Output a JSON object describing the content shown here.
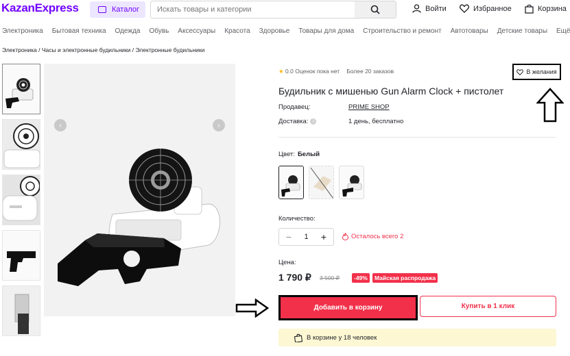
{
  "header": {
    "logo": "KazanExpress",
    "catalog_label": "Каталог",
    "search_placeholder": "Искать товары и категории",
    "login_label": "Войти",
    "favorites_label": "Избранное",
    "cart_label": "Корзина"
  },
  "categories": [
    "Электроника",
    "Бытовая техника",
    "Одежда",
    "Обувь",
    "Аксессуары",
    "Красота",
    "Здоровье",
    "Товары для дома",
    "Строительство и ремонт",
    "Автотовары",
    "Детские товары",
    "Ещё"
  ],
  "breadcrumbs": [
    "Электроника",
    "Часы и электронные будильники",
    "Электронные будильники"
  ],
  "breadcrumb_sep": "/",
  "product": {
    "rating": "0.0",
    "reviews_text": "Оценок пока нет",
    "orders_text": "Более 20 заказов",
    "wishlist_label": "В желания",
    "title": "Будильник с мишенью Gun Alarm Clock + пистолет",
    "seller_label": "Продавец:",
    "seller_name": "PRIME SHOP",
    "delivery_label": "Доставка:",
    "delivery_value": "1 день, бесплатно",
    "color_label": "Цвет:",
    "color_value": "Белый",
    "quantity_label": "Количество:",
    "quantity": "1",
    "stock_text": "Осталось всего 2",
    "price_label": "Цена:",
    "price": "1 790 ₽",
    "old_price": "3 500 ₽",
    "discount": "-49%",
    "sale_badge": "Майская распродажа",
    "add_to_cart": "Добавить в корзину",
    "buy_one_click": "Купить в 1 клик",
    "in_cart_text": "В корзине у 18 человек"
  },
  "colors": {
    "brand": "#7000ff",
    "accent_red": "#f2304a",
    "in_cart_bg": "#fdf7d3"
  }
}
